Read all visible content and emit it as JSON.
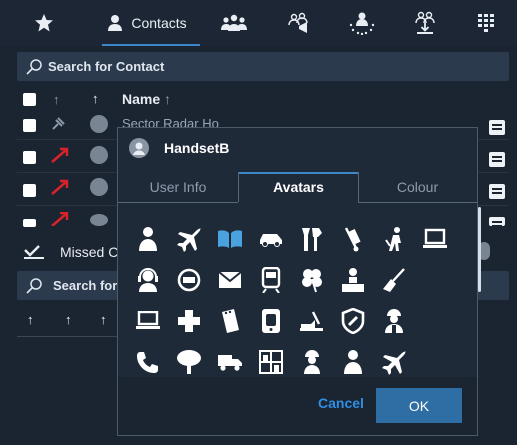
{
  "top_tabs": {
    "favorites_icon": "star-icon",
    "contacts_label": "Contacts",
    "other_icons": [
      "groups-icon",
      "broadcast-icon",
      "conference-icon",
      "download-group-icon",
      "dialpad-icon"
    ]
  },
  "contacts_search": {
    "placeholder": "Search for Contact"
  },
  "contacts_list": {
    "column_name": "Name",
    "first_row_name": "Sector Radar Ho",
    "status_icons": [
      "pin-icon",
      "missed-call-icon",
      "missed-call-icon",
      "missed-call-icon"
    ]
  },
  "missed_panel": {
    "label": "Missed C",
    "search_placeholder": "Search for"
  },
  "dialog": {
    "title": "HandsetB",
    "tabs": [
      "User Info",
      "Avatars",
      "Colour"
    ],
    "active_tab": "Avatars",
    "avatar_icons": [
      [
        "person-icon",
        "airplane-icon",
        "book-icon",
        "car-icon",
        "tools-icon",
        "hand-truck-icon",
        "cleaning-icon",
        "laptop-icon"
      ],
      [
        "headset-agent-icon",
        "no-entry-icon",
        "envelope-icon",
        "train-icon",
        "clover-icon",
        "stamp-desk-icon",
        "broom-icon"
      ],
      [
        "laptop-icon",
        "cross-icon",
        "notepad-icon",
        "tablet-icon",
        "bulldozer-icon",
        "shield-icon",
        "worker-icon"
      ],
      [
        "phone-icon",
        "tree-icon",
        "truck-icon",
        "shelves-icon",
        "hardhat-person-icon",
        "person-icon",
        "airplane-icon"
      ]
    ],
    "cancel_label": "Cancel",
    "ok_label": "OK"
  },
  "colors": {
    "accent": "#3a86c8",
    "background": "#1b2431",
    "dialog": "#1f2a39",
    "ok_button": "#2e6ea4",
    "cancel_link": "#2f8fe4",
    "missed_call": "#d8232a"
  }
}
